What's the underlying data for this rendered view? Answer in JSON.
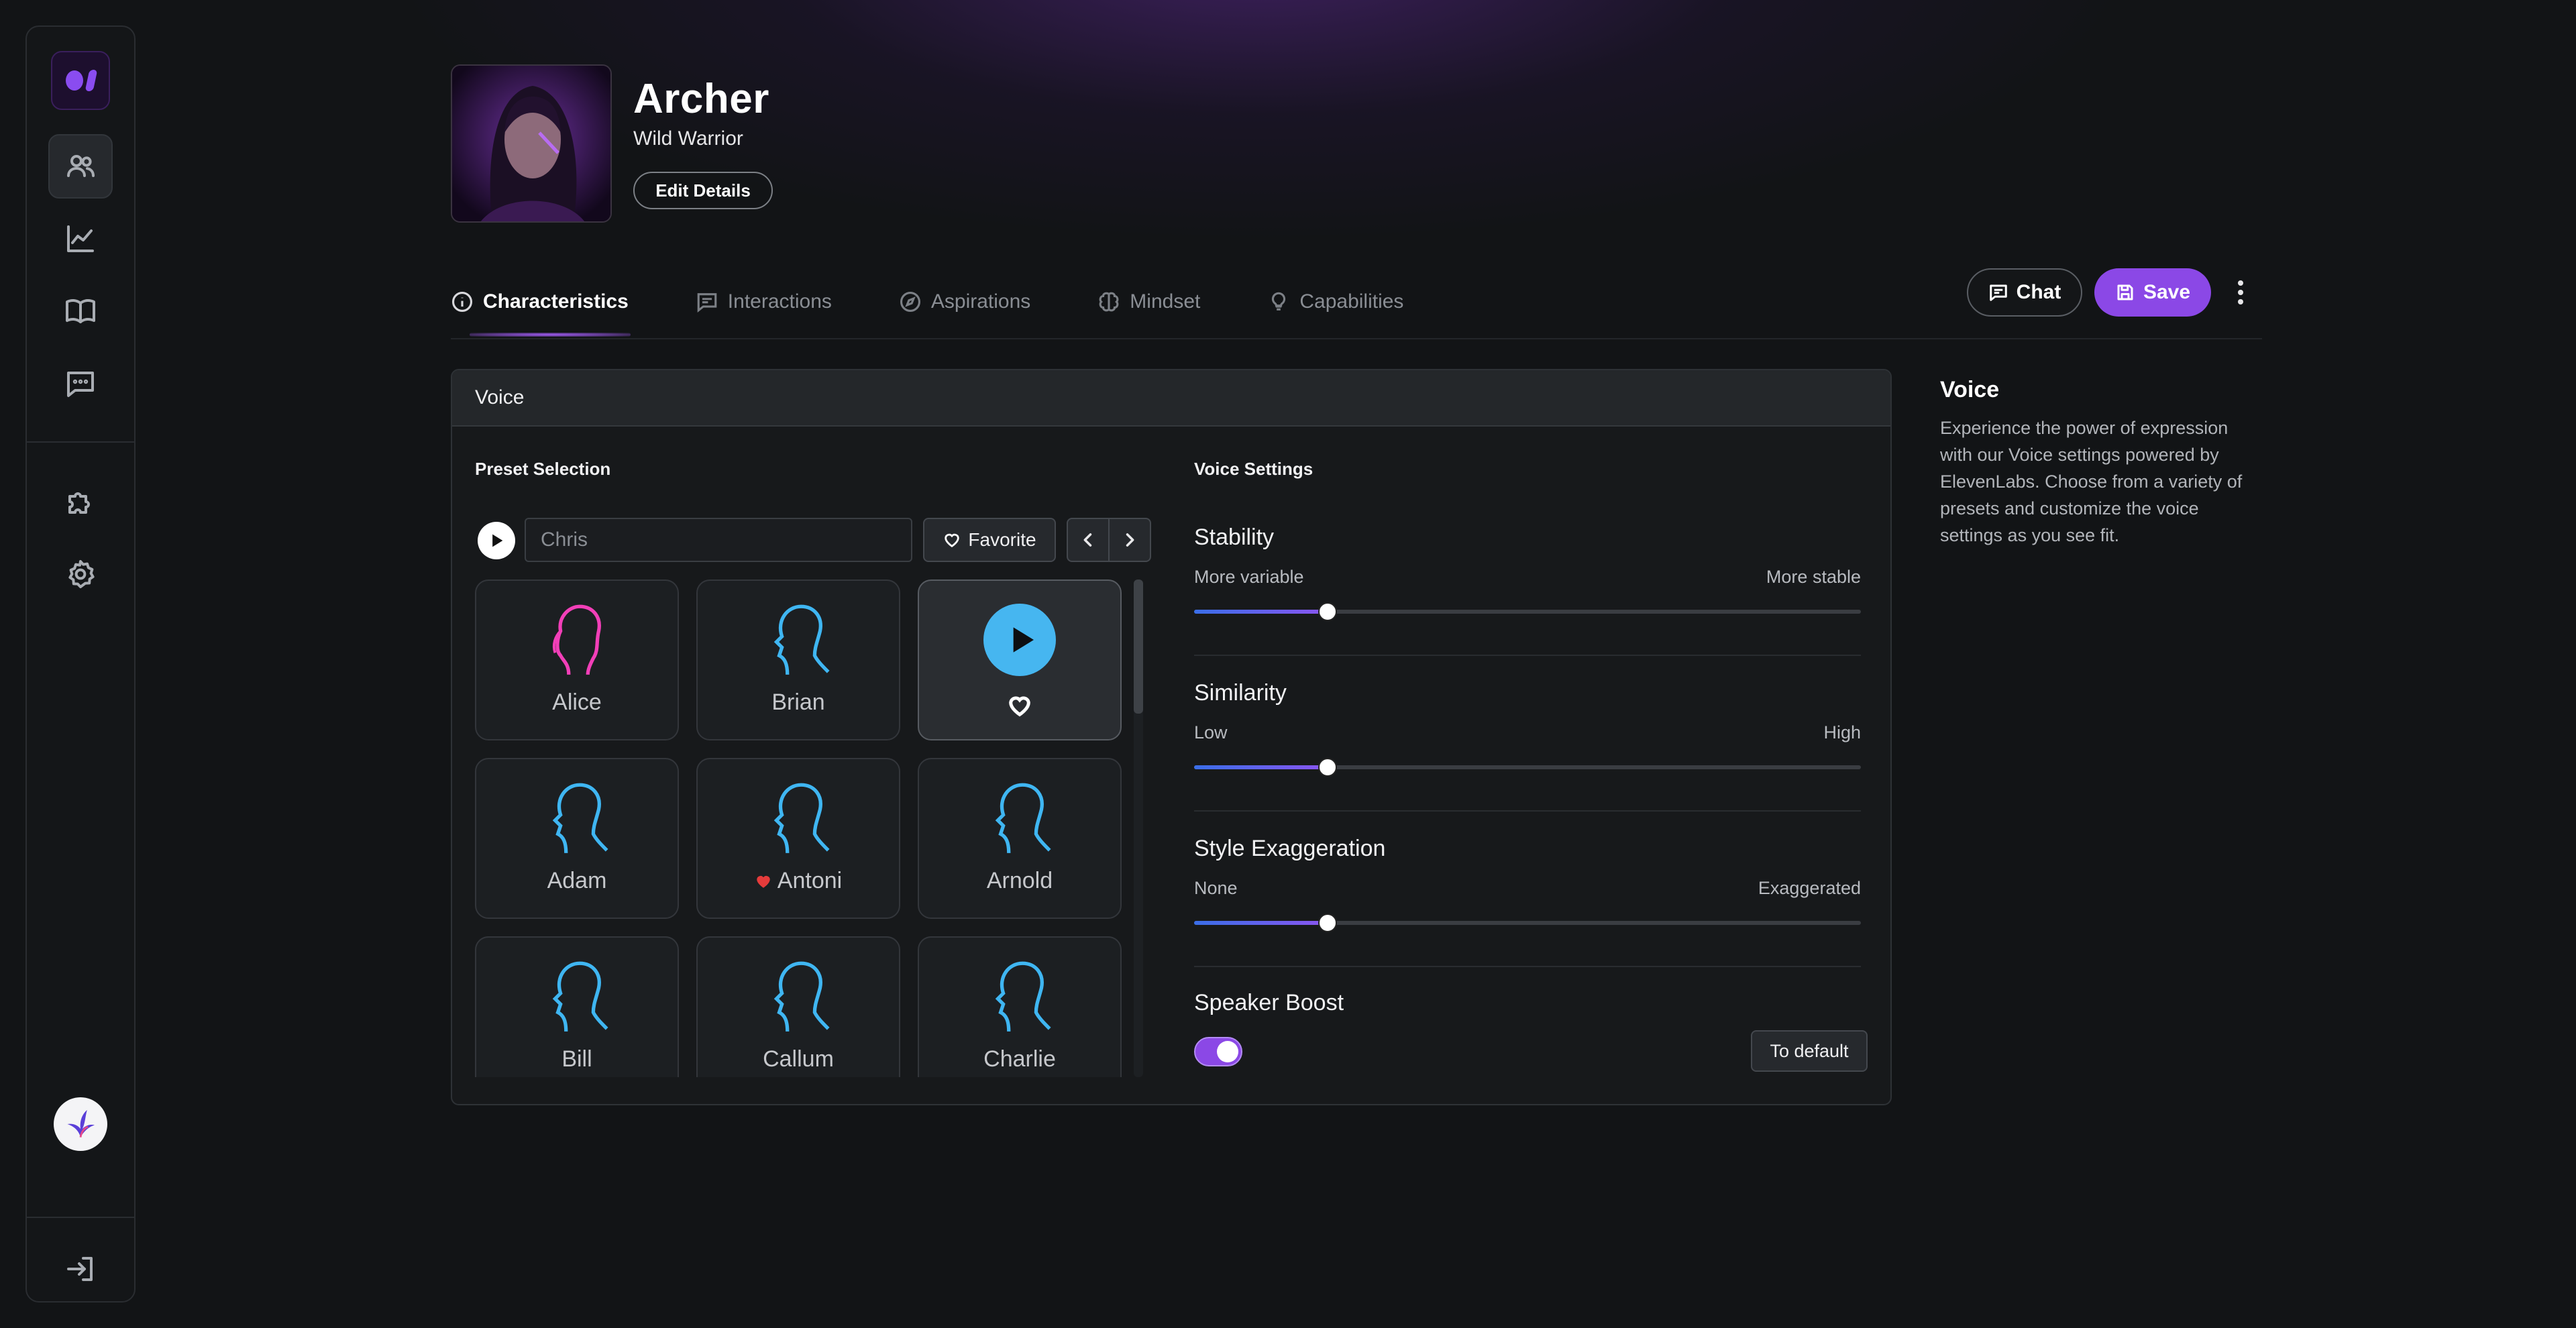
{
  "character": {
    "name": "Archer",
    "subtitle": "Wild Warrior",
    "edit_label": "Edit Details"
  },
  "sidebar": {
    "items": [
      {
        "icon": "users-icon",
        "active": true
      },
      {
        "icon": "chart-icon",
        "active": false
      },
      {
        "icon": "book-icon",
        "active": false
      },
      {
        "icon": "message-icon",
        "active": false
      },
      {
        "icon": "puzzle-icon",
        "active": false
      },
      {
        "icon": "gear-icon",
        "active": false
      }
    ],
    "bottom_icon": "logout-icon"
  },
  "tabs": [
    {
      "label": "Characteristics",
      "icon": "info-icon",
      "active": true
    },
    {
      "label": "Interactions",
      "icon": "chat-icon",
      "active": false
    },
    {
      "label": "Aspirations",
      "icon": "compass-icon",
      "active": false
    },
    {
      "label": "Mindset",
      "icon": "brain-icon",
      "active": false
    },
    {
      "label": "Capabilities",
      "icon": "lightbulb-icon",
      "active": false
    }
  ],
  "actions": {
    "chat_label": "Chat",
    "save_label": "Save"
  },
  "voice": {
    "panel_title": "Voice",
    "preset_label": "Preset Selection",
    "search": {
      "value": "Chris",
      "placeholder": "Chris"
    },
    "favorite_label": "Favorite",
    "presets": [
      {
        "name": "Alice",
        "color": "#f23fb8",
        "favorite": false
      },
      {
        "name": "Brian",
        "color": "#3fb6f2",
        "favorite": false
      },
      {
        "name": "",
        "selected": true,
        "playing": true
      },
      {
        "name": "Adam",
        "color": "#3fb6f2",
        "favorite": false
      },
      {
        "name": "Antoni",
        "color": "#3fb6f2",
        "favorite": true
      },
      {
        "name": "Arnold",
        "color": "#3fb6f2",
        "favorite": false
      },
      {
        "name": "Bill",
        "color": "#3fb6f2",
        "favorite": false
      },
      {
        "name": "Callum",
        "color": "#3fb6f2",
        "favorite": false
      },
      {
        "name": "Charlie",
        "color": "#3fb6f2",
        "favorite": false
      }
    ],
    "settings_label": "Voice Settings",
    "settings": [
      {
        "label": "Stability",
        "min_label": "More variable",
        "max_label": "More stable",
        "value": 0.2
      },
      {
        "label": "Similarity",
        "min_label": "Low",
        "max_label": "High",
        "value": 0.2
      },
      {
        "label": "Style Exaggeration",
        "min_label": "None",
        "max_label": "Exaggerated",
        "value": 0.2
      }
    ],
    "speaker_boost": {
      "label": "Speaker Boost",
      "on": true
    },
    "default_label": "To default"
  },
  "info": {
    "title": "Voice",
    "text": "Experience the power of expression with our Voice settings powered by ElevenLabs. Choose from a variety of presets and customize the voice settings as you see fit."
  },
  "colors": {
    "accent": "#8b48e6",
    "play_blue": "#46b6f0",
    "favorite_red": "#e53b3b"
  }
}
